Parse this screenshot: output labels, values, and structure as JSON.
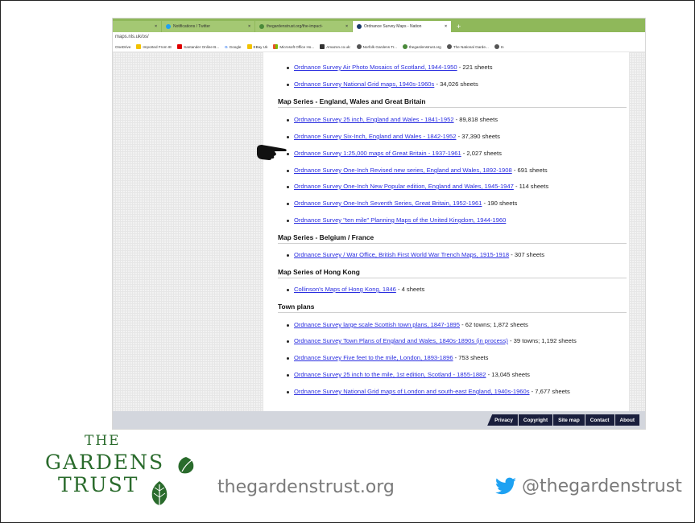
{
  "browser": {
    "tabs": [
      {
        "label": "",
        "favicon_color": "#a4c873"
      },
      {
        "label": "Notifications / Twitter",
        "favicon_color": "#1da1f2"
      },
      {
        "label": "thegardenstrust.org/the-impact-",
        "favicon_color": "#4a8a3a"
      },
      {
        "label": "Ordnance Survey Maps - Nation",
        "favicon_color": "#1b3a6b"
      }
    ],
    "tab_close": "×",
    "new_tab": "+",
    "url": "maps.nls.uk/os/",
    "bookmarks": [
      {
        "label": "OneDrive",
        "color": ""
      },
      {
        "label": "Imported From IE",
        "color": "#f2c200"
      },
      {
        "label": "Santander Online B...",
        "color": "#e00000"
      },
      {
        "label": "Google",
        "color": "#4285f4"
      },
      {
        "label": "EBay Uk",
        "color": "#f2c200"
      },
      {
        "label": "Microsoft Office Ho...",
        "color": "#e8542b"
      },
      {
        "label": "Amazon.co.uk:",
        "color": "#333333"
      },
      {
        "label": "Norfolk Gardens Tr...",
        "color": "#555555"
      },
      {
        "label": "thegardenstrust.org",
        "color": "#4a8a3a"
      },
      {
        "label": "The National Garde...",
        "color": "#555555"
      },
      {
        "label": "In",
        "color": "#555555"
      }
    ]
  },
  "page": {
    "top_items": [
      {
        "link": "Ordnance Survey Air Photo Mosaics of Scotland, 1944-1950",
        "suffix": " - 221 sheets"
      },
      {
        "link": "Ordnance Survey National Grid maps, 1940s-1960s",
        "suffix": " - 34,026 sheets"
      }
    ],
    "sections": [
      {
        "heading": "Map Series - England, Wales and Great Britain",
        "items": [
          {
            "link": "Ordnance Survey 25 inch, England and Wales - 1841-1952",
            "suffix": " - 89,818 sheets"
          },
          {
            "link": "Ordnance Survey Six-Inch, England and Wales - 1842-1952",
            "suffix": " - 37,390 sheets"
          },
          {
            "link": "Ordnance Survey 1:25,000 maps of Great Britain - 1937-1961",
            "suffix": " - 2,027 sheets"
          },
          {
            "link": "Ordnance Survey One-Inch Revised new series, England and Wales, 1892-1908",
            "suffix": " - 691 sheets"
          },
          {
            "link": "Ordnance Survey One-Inch New Popular edition, England and Wales, 1945-1947",
            "suffix": " - 114 sheets"
          },
          {
            "link": "Ordnance Survey One-Inch Seventh Series, Great Britain, 1952-1961",
            "suffix": " - 190 sheets"
          },
          {
            "link": "Ordnance Survey \"ten mile\" Planning Maps of the United Kingdom, 1944-1960",
            "suffix": ""
          }
        ]
      },
      {
        "heading": "Map Series - Belgium / France",
        "items": [
          {
            "link": "Ordnance Survey / War Office, British First World War Trench Maps, 1915-1918",
            "suffix": " - 307 sheets"
          }
        ]
      },
      {
        "heading": "Map Series of Hong Kong",
        "items": [
          {
            "link": "Collinson's Maps of Hong Kong, 1846",
            "suffix": " - 4 sheets"
          }
        ]
      },
      {
        "heading": "Town plans",
        "items": [
          {
            "link": "Ordnance Survey large scale Scottish town plans, 1847-1895",
            "suffix": " - 62 towns; 1,872 sheets"
          },
          {
            "link": "Ordnance Survey Town Plans of England and Wales, 1840s-1890s (in process)",
            "suffix": " - 39 towns; 1,192 sheets"
          },
          {
            "link": "Ordnance Survey Five feet to the mile, London, 1893-1896",
            "suffix": " - 753 sheets"
          },
          {
            "link": "Ordnance Survey 25 inch to the mile, 1st edition, Scotland - 1855-1882",
            "suffix": " - 13,045 sheets"
          },
          {
            "link": "Ordnance Survey National Grid maps of London and south-east England, 1940s-1960s",
            "suffix": " - 7,677 sheets"
          }
        ]
      }
    ],
    "footer_links": [
      "Privacy",
      "Copyright",
      "Site map",
      "Contact",
      "About"
    ]
  },
  "branding": {
    "logo_line1": "THE",
    "logo_line2": "GARDENS",
    "logo_line3": "TRUST",
    "website": "thegardenstrust.org",
    "twitter_handle": "@thegardenstrust",
    "brand_green": "#2a6b2c",
    "twitter_blue": "#1da1f2"
  },
  "icons": [
    "pointing-hand-icon",
    "leaf-icon",
    "twitter-bird-icon",
    "globe-icon"
  ]
}
